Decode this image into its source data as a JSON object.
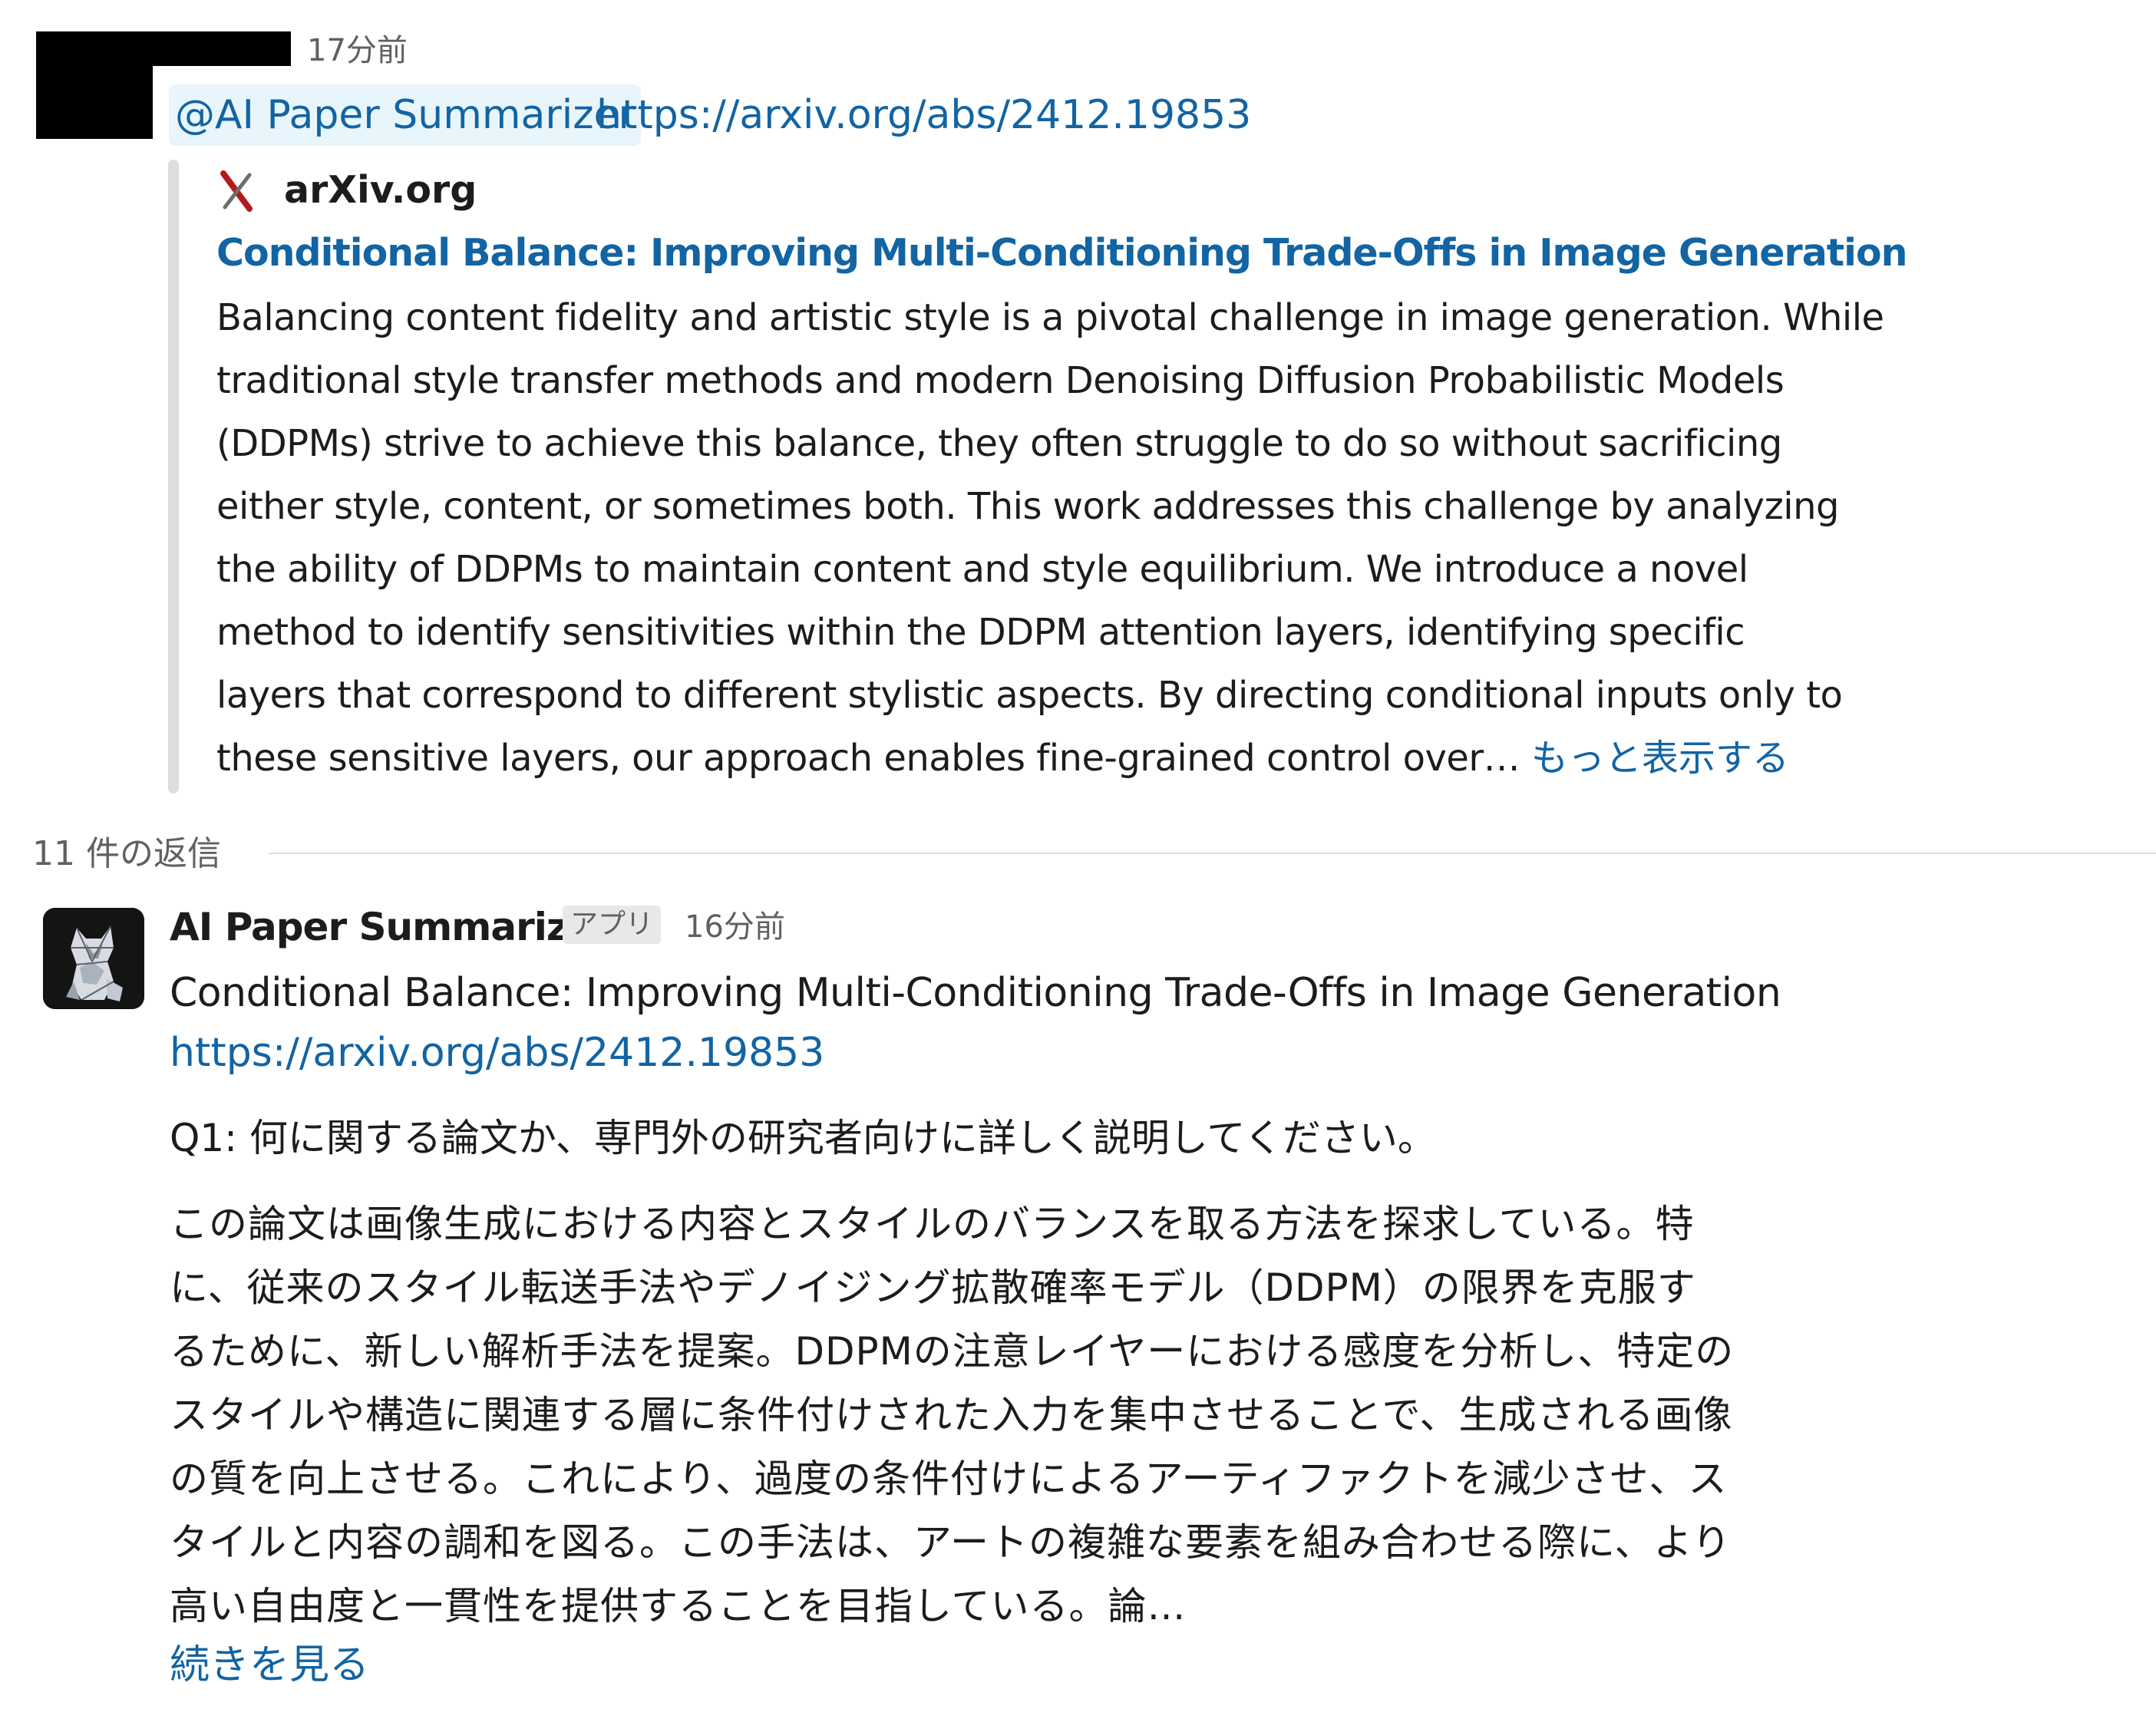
{
  "message": {
    "timestamp": "17分前",
    "mention": "@AI Paper Summarizer",
    "url": "https://arxiv.org/abs/2412.19853"
  },
  "unfurl": {
    "site_name": "arXiv.org",
    "icon": "arxiv-logo-icon",
    "title": "Conditional Balance: Improving Multi-Conditioning Trade-Offs in Image Generation",
    "description_lines": [
      "Balancing content fidelity and artistic style is a pivotal challenge in image generation. While",
      "traditional style transfer methods and modern Denoising Diffusion Probabilistic Models",
      "(DDPMs) strive to achieve this balance, they often struggle to do so without sacrificing",
      "either style, content, or sometimes both. This work addresses this challenge by analyzing",
      "the ability of DDPMs to maintain content and style equilibrium. We introduce a novel",
      "method to identify sensitivities within the DDPM attention layers, identifying specific",
      "layers that correspond to different stylistic aspects. By directing conditional inputs only to",
      "these sensitive layers, our approach enables fine-grained control over…"
    ],
    "show_more": "もっと表示する"
  },
  "thread": {
    "reply_count": "11 件の返信"
  },
  "reply": {
    "author": "AI Paper Summarizer",
    "badge": "アプリ",
    "timestamp": "16分前",
    "title": "Conditional Balance: Improving Multi-Conditioning Trade-Offs in Image Generation",
    "url": "https://arxiv.org/abs/2412.19853",
    "question": "Q1: 何に関する論文か、専門外の研究者向けに詳しく説明してください。",
    "answer_lines": [
      "この論文は画像生成における内容とスタイルのバランスを取る方法を探求している。特",
      "に、従来のスタイル転送手法やデノイジング拡散確率モデル（DDPM）の限界を克服す",
      "るために、新しい解析手法を提案。DDPMの注意レイヤーにおける感度を分析し、特定の",
      "スタイルや構造に関連する層に条件付けされた入力を集中させることで、生成される画像",
      "の質を向上させる。これにより、過度の条件付けによるアーティファクトを減少させ、ス",
      "タイルと内容の調和を図る。この手法は、アートの複雑な要素を組み合わせる際に、より",
      "高い自由度と一貫性を提供することを目指している。論…"
    ],
    "see_more": "続きを見る"
  },
  "colors": {
    "link": "#1264a3",
    "mention_bg": "#e8f5fa",
    "arxiv_red": "#b31b1b",
    "text": "#1d1c1d",
    "muted": "#616061"
  }
}
